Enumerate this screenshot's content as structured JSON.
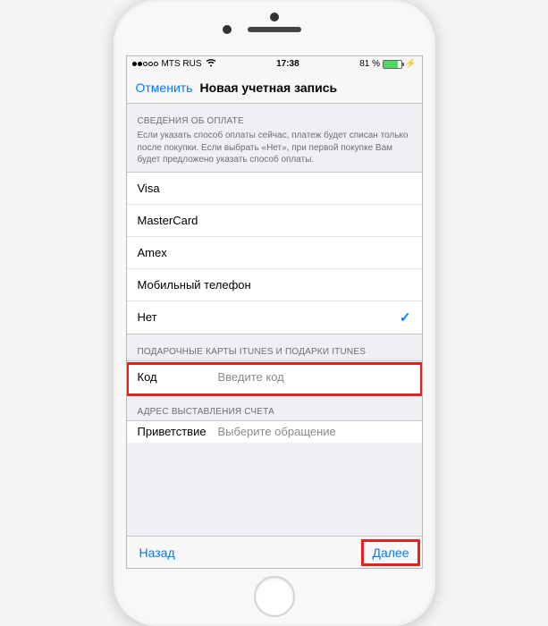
{
  "status": {
    "carrier": "MTS RUS",
    "time": "17:38",
    "battery_pct": "81 %"
  },
  "nav": {
    "cancel": "Отменить",
    "title": "Новая учетная запись"
  },
  "payment_section": {
    "header": "СВЕДЕНИЯ ОБ ОПЛАТЕ",
    "desc": "Если указать способ оплаты сейчас, платеж будет списан только после покупки. Если выбрать «Нет», при первой покупке Вам будет предложено указать способ оплаты.",
    "options": [
      "Visa",
      "MasterCard",
      "Amex",
      "Мобильный телефон",
      "Нет"
    ],
    "selected_index": 4
  },
  "gift_section": {
    "header": "ПОДАРОЧНЫЕ КАРТЫ ITUNES И ПОДАРКИ ITUNES",
    "code_label": "Код",
    "code_placeholder": "Введите код"
  },
  "billing_section": {
    "header": "АДРЕС ВЫСТАВЛЕНИЯ СЧЕТА",
    "salutation_label": "Приветствие",
    "salutation_placeholder": "Выберите обращение"
  },
  "toolbar": {
    "back": "Назад",
    "next": "Далее"
  }
}
